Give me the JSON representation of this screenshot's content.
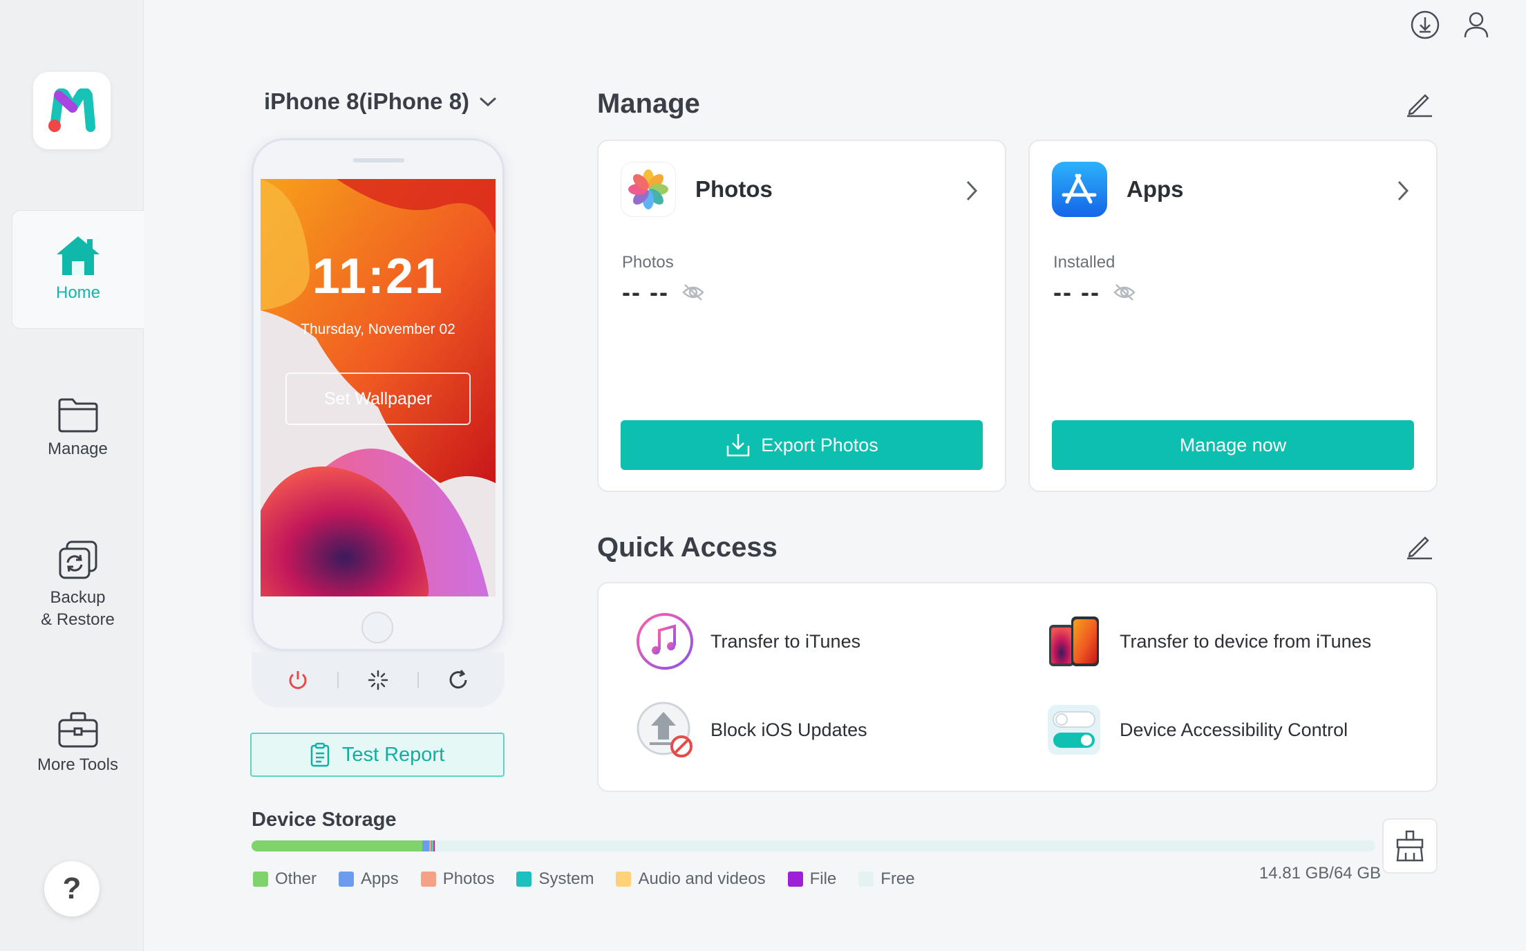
{
  "window": {
    "title": ""
  },
  "sidebar": {
    "items": [
      {
        "label": "Home",
        "icon": "home-icon",
        "active": true
      },
      {
        "label": "Manage",
        "icon": "folder-icon",
        "active": false
      },
      {
        "label": "Backup\n& Restore",
        "icon": "backup-icon",
        "active": false
      },
      {
        "label": "More Tools",
        "icon": "toolbox-icon",
        "active": false
      }
    ],
    "help_label": "?"
  },
  "device": {
    "name": "iPhone 8(iPhone 8)",
    "lock_time": "11:21",
    "lock_date": "Thursday, November 02",
    "wallpaper_button": "Set Wallpaper",
    "test_report_button": "Test Report"
  },
  "manage": {
    "title": "Manage",
    "photos": {
      "title": "Photos",
      "stat_label": "Photos",
      "stat_value": "-- --",
      "action": "Export Photos"
    },
    "apps": {
      "title": "Apps",
      "stat_label": "Installed",
      "stat_value": "-- --",
      "action": "Manage now"
    }
  },
  "quick_access": {
    "title": "Quick Access",
    "items": [
      {
        "label": "Transfer to iTunes",
        "icon": "itunes-icon"
      },
      {
        "label": "Transfer to device from iTunes",
        "icon": "device-transfer-icon"
      },
      {
        "label": "Block iOS Updates",
        "icon": "block-update-icon"
      },
      {
        "label": "Device Accessibility Control",
        "icon": "toggle-icon"
      }
    ]
  },
  "storage": {
    "title": "Device Storage",
    "used_text": "14.81 GB/64 GB",
    "segments": [
      {
        "name": "Other",
        "color": "#7ed36b",
        "fraction": 0.152
      },
      {
        "name": "Apps",
        "color": "#6c9cf0",
        "fraction": 0.006
      },
      {
        "name": "Photos",
        "color": "#f5a183",
        "fraction": 0.002
      },
      {
        "name": "System",
        "color": "#1cc0bf",
        "fraction": 0.001
      },
      {
        "name": "Audio and videos",
        "color": "#ffd27a",
        "fraction": 0.001
      },
      {
        "name": "File",
        "color": "#9b20d6",
        "fraction": 0.001
      },
      {
        "name": "Free",
        "color": "#e4f2f1",
        "fraction": 0.837
      }
    ]
  },
  "colors": {
    "accent": "#0cbfae",
    "power": "#e84a4a"
  }
}
